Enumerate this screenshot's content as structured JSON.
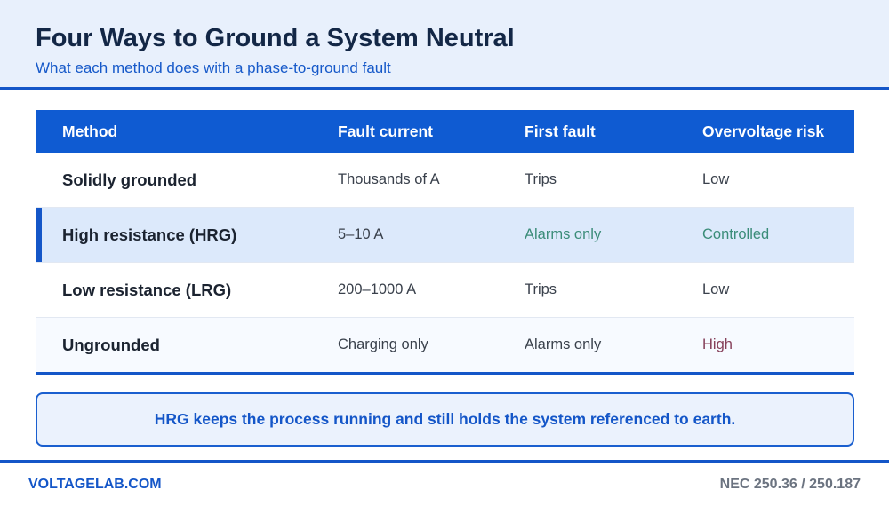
{
  "header": {
    "title": "Four Ways to Ground a System Neutral",
    "subtitle": "What each method does with a phase-to-ground fault"
  },
  "table": {
    "columns": [
      "Method",
      "Fault current",
      "First fault",
      "Overvoltage risk"
    ],
    "rows": [
      [
        "Solidly grounded",
        "Thousands of A",
        "Trips",
        "Low"
      ],
      [
        "High resistance (HRG)",
        "5–10 A",
        "Alarms only",
        "Controlled"
      ],
      [
        "Low resistance (LRG)",
        "200–1000 A",
        "Trips",
        "Low"
      ],
      [
        "Ungrounded",
        "Charging only",
        "Alarms only",
        "High"
      ]
    ],
    "highlighted_row": 1
  },
  "callout": {
    "text": "HRG keeps the process running and still holds the system referenced to earth."
  },
  "footer": {
    "left": "VOLTAGELAB.COM",
    "right": "NEC 250.36 / 250.187"
  },
  "colors": {
    "brand_blue": "#1456c8",
    "header_bg": "#e8f0fc",
    "table_head": "#0f5bd2",
    "highlight_row": "#dce9fb",
    "positive_text": "#3a8c78",
    "risk_text": "#86405a"
  }
}
